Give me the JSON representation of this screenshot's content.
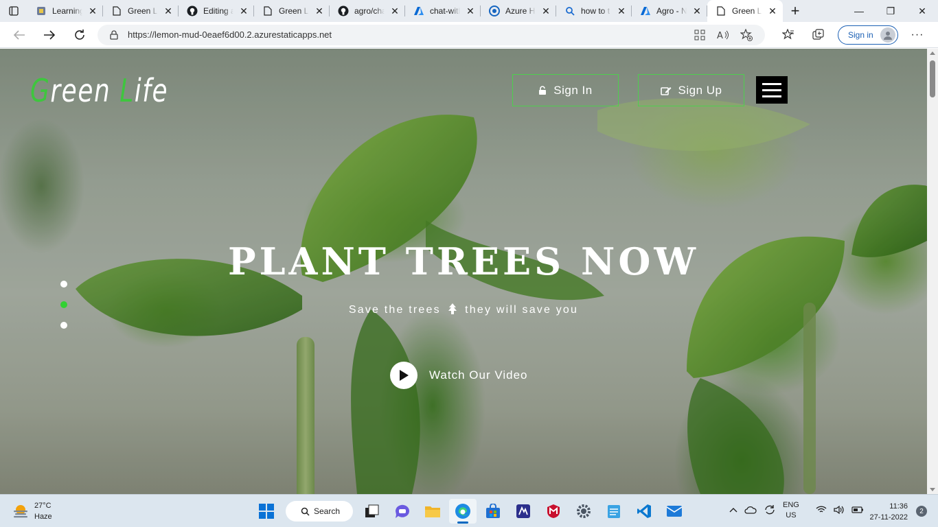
{
  "browser": {
    "tabs": [
      {
        "title": "Learning",
        "favicon": "learning-icon",
        "active": false
      },
      {
        "title": "Green Li",
        "favicon": "page-icon",
        "active": false
      },
      {
        "title": "Editing a",
        "favicon": "github-icon",
        "active": false
      },
      {
        "title": "Green Li",
        "favicon": "page-icon",
        "active": false
      },
      {
        "title": "agro/cha",
        "favicon": "github-icon",
        "active": false
      },
      {
        "title": "chat-with",
        "favicon": "azure-icon",
        "active": false
      },
      {
        "title": "Azure H",
        "favicon": "azure-health-icon",
        "active": false
      },
      {
        "title": "how to t",
        "favicon": "search-icon",
        "active": false
      },
      {
        "title": "Agro - N",
        "favicon": "azure-icon",
        "active": false
      },
      {
        "title": "Green Li",
        "favicon": "page-icon",
        "active": true
      }
    ],
    "url": "https://lemon-mud-0eaef6d00.2.azurestaticapps.net",
    "signin_label": "Sign in"
  },
  "site": {
    "logo": {
      "first_initial": "G",
      "first_rest": "reen ",
      "second_initial": "L",
      "second_rest": "ife"
    },
    "signin_label": "Sign In",
    "signup_label": "Sign Up",
    "hero_title": "PLANT TREES NOW",
    "hero_sub_part1": "Save the trees",
    "hero_sub_part2": "they will save you",
    "video_label": "Watch Our Video",
    "slider_active_index": 1,
    "accent_color": "#33d133"
  },
  "taskbar": {
    "temperature": "27°C",
    "condition": "Haze",
    "search_label": "Search",
    "lang_top": "ENG",
    "lang_bottom": "US",
    "time": "11:36",
    "date": "27-11-2022",
    "notification_count": "2"
  }
}
